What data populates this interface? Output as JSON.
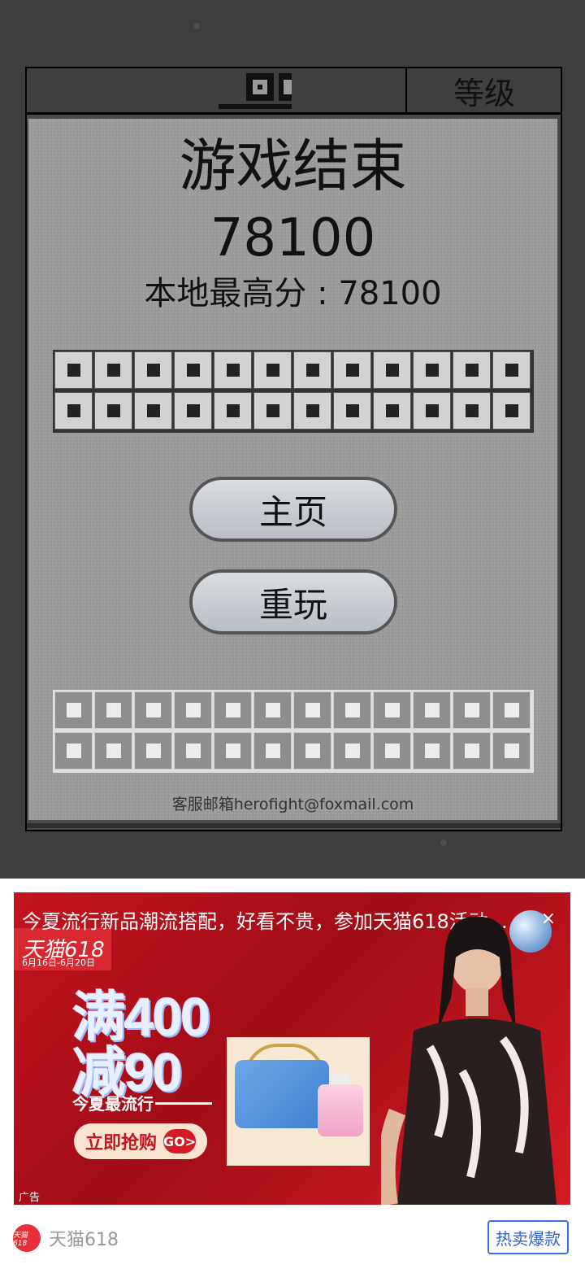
{
  "header": {
    "level_tab": "等级"
  },
  "game_over": {
    "title": "游戏结束",
    "score": "78100",
    "best_score": "本地最高分 : 78100"
  },
  "buttons": {
    "home": "主页",
    "replay": "重玩"
  },
  "contact": {
    "email": "客服邮箱herofight@foxmail.com"
  },
  "ad": {
    "caption": "今夏流行新品潮流搭配，好看不贵，参加天猫618活动满...",
    "brand": "天猫618",
    "dates": "6月16日-6月20日",
    "promo_line_1": "满400",
    "promo_line_2": "减90",
    "promo_sub": "今夏最流行",
    "cta": "立即抢购",
    "cta_badge": "GO>",
    "label": "广告",
    "close": "×"
  },
  "footer": {
    "advertiser": "天猫618",
    "logo_text": "天猫618",
    "button": "热卖爆款"
  },
  "colors": {
    "ad_red": "#c4141e",
    "link_blue": "#2f62d6"
  }
}
